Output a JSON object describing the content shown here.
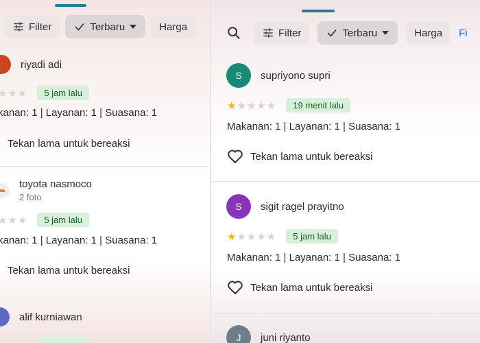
{
  "left": {
    "filters": {
      "filter": "Filter",
      "newest": "Terbaru",
      "price": "Harga"
    },
    "reviews": [
      {
        "name": "riyadi adi",
        "time": "5 jam lalu",
        "ratings": "kanan: 1 | Layanan: 1 | Suasana: 1",
        "react": "Tekan lama untuk bereaksi",
        "avatar_color": "#c8451f"
      },
      {
        "name": "toyota nasmoco",
        "sub": "2 foto",
        "time": "5 jam lalu",
        "ratings": "kanan: 1 | Layanan: 1 | Suasana: 1",
        "react": "Tekan lama untuk bereaksi"
      },
      {
        "name": "alif kurniawan",
        "avatar_color": "#5c6bc0"
      }
    ]
  },
  "right": {
    "filters": {
      "filter": "Filter",
      "newest": "Terbaru",
      "price": "Harga",
      "more": "Fi"
    },
    "reviews": [
      {
        "initial": "S",
        "name": "supriyono supri",
        "stars": 1,
        "time": "19 menit lalu",
        "ratings": "Makanan: 1 | Layanan: 1 | Suasana: 1",
        "react": "Tekan lama untuk bereaksi",
        "avatar_color": "#1a8a78"
      },
      {
        "initial": "S",
        "name": "sigit ragel prayitno",
        "stars": 1,
        "time": "5 jam lalu",
        "ratings": "Makanan: 1 | Layanan: 1 | Suasana: 1",
        "react": "Tekan lama untuk bereaksi",
        "avatar_color": "#8a35b5"
      },
      {
        "initial": "J",
        "name": "juni riyanto",
        "avatar_color": "#6f7f8a"
      }
    ]
  }
}
